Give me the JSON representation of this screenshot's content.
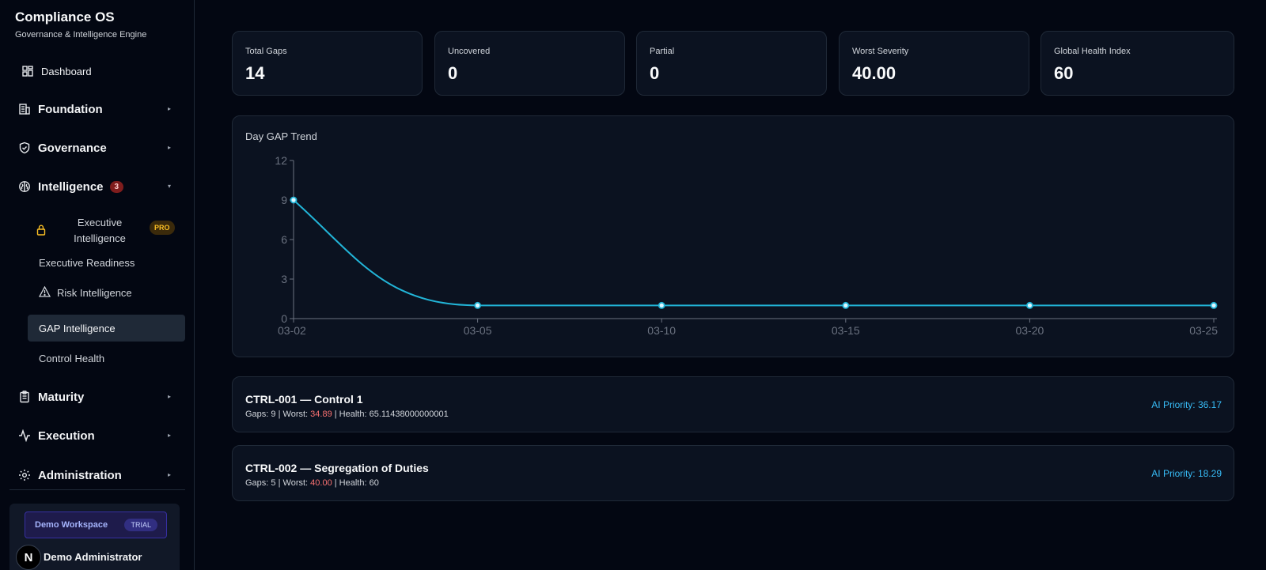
{
  "brand": {
    "title": "Compliance OS",
    "subtitle": "Governance & Intelligence Engine"
  },
  "sidebar": {
    "dashboard": "Dashboard",
    "foundation": "Foundation",
    "governance": "Governance",
    "intelligence": "Intelligence",
    "intelligence_count": "3",
    "executive_intelligence_line1": "Executive",
    "executive_intelligence_line2": "Intelligence",
    "pro_badge": "PRO",
    "executive_readiness": "Executive Readiness",
    "risk_intelligence": "Risk Intelligence",
    "gap_intelligence": "GAP Intelligence",
    "control_health": "Control Health",
    "maturity": "Maturity",
    "execution": "Execution",
    "administration": "Administration",
    "workspace_name": "Demo Workspace",
    "workspace_plan": "TRIAL",
    "user_name": "Demo Administrator",
    "avatar_letter": "N"
  },
  "stats": [
    {
      "label": "Total Gaps",
      "value": "14"
    },
    {
      "label": "Uncovered",
      "value": "0"
    },
    {
      "label": "Partial",
      "value": "0"
    },
    {
      "label": "Worst Severity",
      "value": "40.00"
    },
    {
      "label": "Global Health Index",
      "value": "60"
    }
  ],
  "chart_title": "Day GAP Trend",
  "chart_data": {
    "type": "line",
    "title": "Day GAP Trend",
    "x": [
      "03-02",
      "03-05",
      "03-10",
      "03-15",
      "03-20",
      "03-25"
    ],
    "values": [
      9,
      1,
      1,
      1,
      1,
      1
    ],
    "yticks": [
      "0",
      "3",
      "6",
      "9",
      "12"
    ],
    "ylim": [
      0,
      12
    ],
    "grid": false,
    "color": "#22b5d8"
  },
  "controls": [
    {
      "title": "CTRL-001 — Control 1",
      "gaps": "Gaps: 9",
      "worst_label": "Worst:",
      "worst": "34.89",
      "health": "Health: 65.11438000000001",
      "priority": "AI Priority: 36.17"
    },
    {
      "title": "CTRL-002 — Segregation of Duties",
      "gaps": "Gaps: 5",
      "worst_label": "Worst:",
      "worst": "40.00",
      "health": "Health: 60",
      "priority": "AI Priority: 18.29"
    }
  ],
  "colors": {
    "accent": "#22b5d8",
    "danger": "#f87171",
    "pro": "#fbbf24"
  }
}
